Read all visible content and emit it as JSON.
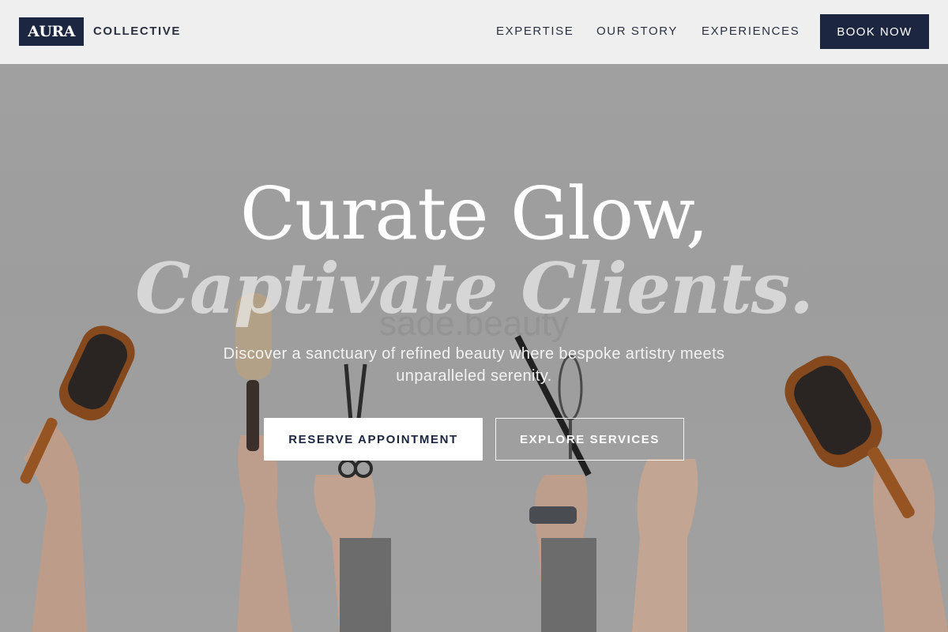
{
  "brand": {
    "logo_text": "AURA",
    "logo_word": "COLLECTIVE"
  },
  "nav": {
    "items": [
      {
        "label": "EXPERTISE"
      },
      {
        "label": "OUR STORY"
      },
      {
        "label": "EXPERIENCES"
      }
    ],
    "cta_label": "BOOK NOW"
  },
  "hero": {
    "title_line1": "Curate Glow,",
    "title_line2": "Captivate Clients.",
    "watermark": "sade.beauty",
    "subtitle": "Discover a sanctuary of refined beauty where bespoke artistry meets unparalleled serenity.",
    "primary_button": "RESERVE APPOINTMENT",
    "secondary_button": "EXPLORE SERVICES"
  },
  "colors": {
    "navy": "#1c2640",
    "header_bg": "#efefef",
    "hero_bg": "#a5a5a5"
  },
  "hero_image": {
    "icons": [
      "paddle-brush-icon",
      "round-brush-icon",
      "scissors-icon",
      "tint-brush-icon",
      "whisk-icon",
      "paddle-brush-icon"
    ]
  }
}
